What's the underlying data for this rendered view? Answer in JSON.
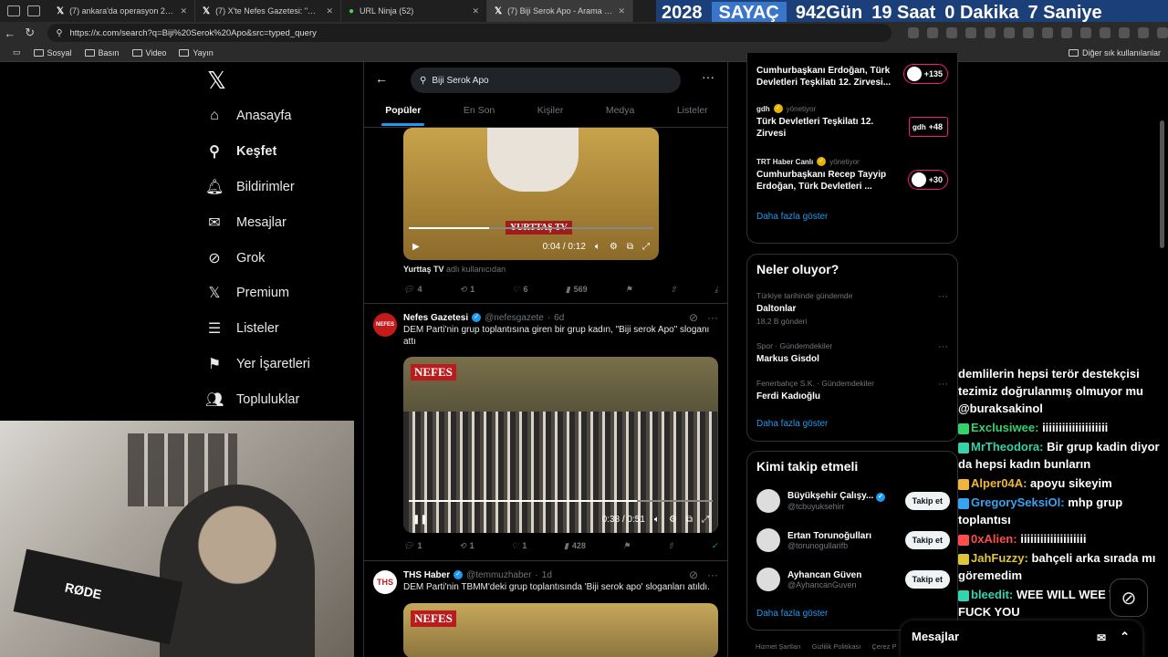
{
  "browser": {
    "tabs": [
      {
        "label": "(7) ankara'da operasyon 23 - Arama / X",
        "icon": "x-logo"
      },
      {
        "label": "(7) X'te Nefes Gazetesi: \"Adana'da…",
        "icon": "x-logo"
      },
      {
        "label": "URL Ninja (52)",
        "icon": "ninja"
      },
      {
        "label": "(7) Biji Serok Apo - Arama / X",
        "icon": "x-logo",
        "active": true
      }
    ],
    "url": "https://x.com/search?q=Biji%20Serok%20Apo&src=typed_query",
    "bookmarks": [
      "Sosyal",
      "Basın",
      "Video",
      "Yayın"
    ],
    "other_bookmarks": "Diğer sık kullanılanlar"
  },
  "counter": {
    "year": "2028",
    "label": "SAYAÇ",
    "days": "942",
    "days_label": "Gün",
    "hours": "19",
    "hours_label": "Saat",
    "minutes": "0",
    "minutes_label": "Dakika",
    "seconds": "7",
    "seconds_label": "Saniye"
  },
  "nav": {
    "items": [
      {
        "label": "Anasayfa",
        "icon": "home-icon"
      },
      {
        "label": "Keşfet",
        "icon": "search-icon",
        "selected": true
      },
      {
        "label": "Bildirimler",
        "icon": "bell-icon",
        "badge": "7"
      },
      {
        "label": "Mesajlar",
        "icon": "mail-icon"
      },
      {
        "label": "Grok",
        "icon": "grok-icon"
      },
      {
        "label": "Premium",
        "icon": "x-icon"
      },
      {
        "label": "Listeler",
        "icon": "list-icon"
      },
      {
        "label": "Yer İşaretleri",
        "icon": "bookmark-icon"
      },
      {
        "label": "Topluluklar",
        "icon": "people-icon"
      }
    ]
  },
  "search": {
    "query": "Biji Serok Apo",
    "tabs": [
      "Popüler",
      "En Son",
      "Kişiler",
      "Medya",
      "Listeler"
    ]
  },
  "post0": {
    "video_time": "0:04 / 0:12",
    "progress": 0.33,
    "brand": "YURTTAŞ TV",
    "source_name": "Yurttaş TV",
    "source_suffix": "adlı kullanıcıdan",
    "replies": "4",
    "reposts": "1",
    "likes": "6",
    "views": "569"
  },
  "post1": {
    "name": "Nefes Gazetesi",
    "handle": "@nefesgazete",
    "time": "6d",
    "text": "DEM Parti'nin grup toplantısına giren bir grup kadın, \"Biji serok Apo\" sloganı attı",
    "brand": "NEFES",
    "video_time": "0:38 / 0:51",
    "progress": 0.75,
    "replies": "1",
    "reposts": "1",
    "likes": "1",
    "views": "428"
  },
  "post2": {
    "name": "THS Haber",
    "handle": "@temmuzhaber",
    "time": "1d",
    "text": "DEM Parti'nin TBMM'deki grup toplantısında 'Biji serok apo' sloganları atıldı.",
    "brand": "NEFES"
  },
  "live": {
    "items": [
      {
        "host": "Cumhurbaşkanı Erdoğan, Türk Devletleri Teşkilatı 12. Zirvesi...",
        "count": "+135"
      },
      {
        "host": "gdh",
        "role": "yönetiyor",
        "title": "Türk Devletleri Teşkilatı 12. Zirvesi",
        "count": "+48"
      },
      {
        "host": "TRT Haber Canlı",
        "role": "yönetiyor",
        "title": "Cumhurbaşkanı Recep Tayyip Erdoğan, Türk Devletleri ...",
        "count": "+30"
      }
    ],
    "more": "Daha fazla göster"
  },
  "trends": {
    "title": "Neler oluyor?",
    "items": [
      {
        "context": "Türkiye tarihinde gündemde",
        "name": "Daltonlar",
        "count": "18,2 B gönderi"
      },
      {
        "context": "Spor · Gündemdekiler",
        "name": "Markus Gisdol",
        "count": ""
      },
      {
        "context": "Fenerbahçe S.K. · Gündemdekiler",
        "name": "Ferdi Kadıoğlu",
        "count": ""
      }
    ],
    "more": "Daha fazla göster"
  },
  "who": {
    "title": "Kimi takip etmeli",
    "items": [
      {
        "name": "Büyükşehir Çalışy...",
        "handle": "@tcbuyuksehirr",
        "verified": true
      },
      {
        "name": "Ertan Torunoğulları",
        "handle": "@torunogullarifb"
      },
      {
        "name": "Ayhancan Güven",
        "handle": "@AyhancanGuven"
      }
    ],
    "follow": "Takip et",
    "more": "Daha fazla göster"
  },
  "footer": [
    "Hizmet Şartları",
    "Gizlilik Politikası",
    "Çerez P"
  ],
  "messages": "Mesajlar",
  "webcam_mic": "RØDE",
  "chat": [
    {
      "user": "",
      "text": "demlilerin hepsi terör destekçisi tezimiz doğrulanmış olmuyor mu @buraksakinol",
      "color": "#ffffff"
    },
    {
      "user": "Exclusiwee:",
      "text": "iiiiiiiiiiiiiiiiiiii",
      "color": "#36d16a"
    },
    {
      "user": "MrTheodora:",
      "text": "Bir grup kadin diyor da hepsi kadın bunların",
      "color": "#36d1a6"
    },
    {
      "user": "Alper04A:",
      "text": "apoyu sikeyim",
      "color": "#f0b63a"
    },
    {
      "user": "GregorySeksiOl:",
      "text": "mhp grup toplantısı",
      "color": "#3aa3f0"
    },
    {
      "user": "0xAlien:",
      "text": "iiiiiiiiiiiiiiiiiiii",
      "color": "#ff4d4d"
    },
    {
      "user": "JahFuzzy:",
      "text": "bahçeli arka sırada mı göremedim",
      "color": "#e0c43a"
    },
    {
      "user": "bleedit:",
      "text": "WEE WILL WEE WILL FUCK YOU",
      "color": "#2fd6b0"
    }
  ]
}
